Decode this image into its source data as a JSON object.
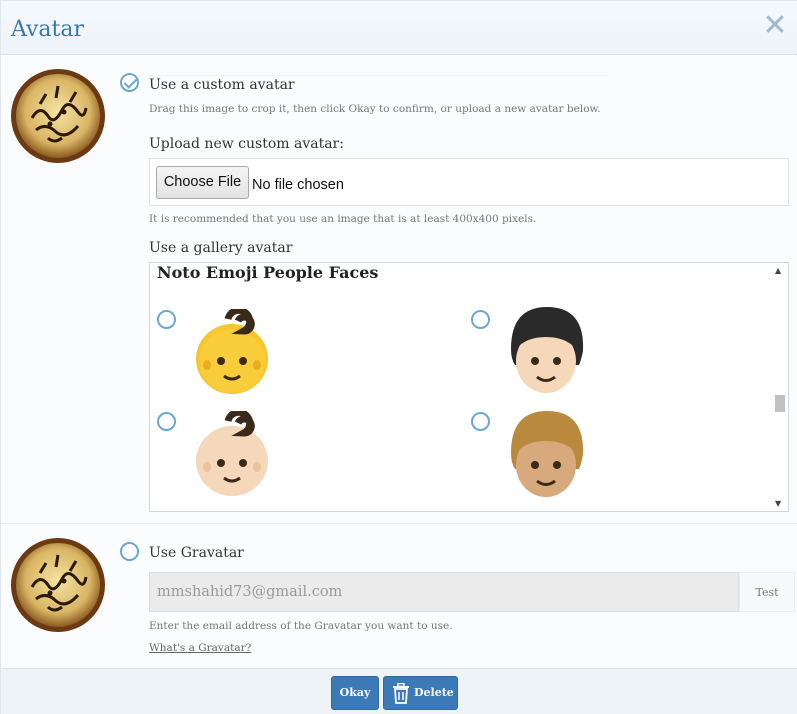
{
  "dialog": {
    "title": "Avatar",
    "close_icon": "close-icon"
  },
  "custom_avatar": {
    "option_label": "Use a custom avatar",
    "selected": true,
    "crop_hint": "Drag this image to crop it, then click Okay to confirm, or upload a new avatar below.",
    "upload_label": "Upload new custom avatar:",
    "choose_file_label": "Choose File",
    "no_file_text": "No file chosen",
    "size_hint": "It is recommended that you use an image that is at least 400x400 pixels."
  },
  "gallery": {
    "label": "Use a gallery avatar",
    "set_title": "Noto Emoji People Faces",
    "items": [
      {
        "name": "baby-face-emoji",
        "skin": "#f7c52e",
        "selected": false
      },
      {
        "name": "person-face-emoji",
        "skin": "#f5d7b9",
        "selected": false
      },
      {
        "name": "baby-light-skin-emoji",
        "skin": "#f5d7b9",
        "selected": false
      },
      {
        "name": "person-medium-skin-emoji",
        "skin": "#d7a97c",
        "selected": false
      }
    ]
  },
  "gravatar": {
    "option_label": "Use Gravatar",
    "selected": false,
    "email": "mmshahid73@gmail.com",
    "test_label": "Test",
    "email_hint": "Enter the email address of the Gravatar you want to use.",
    "help_link": "What's a Gravatar?"
  },
  "footer": {
    "okay_label": "Okay",
    "delete_label": "Delete",
    "delete_icon": "trash-icon"
  },
  "colors": {
    "accent": "#3b7ab7",
    "title": "#3a78a8",
    "radio": "#6aa7d4"
  }
}
